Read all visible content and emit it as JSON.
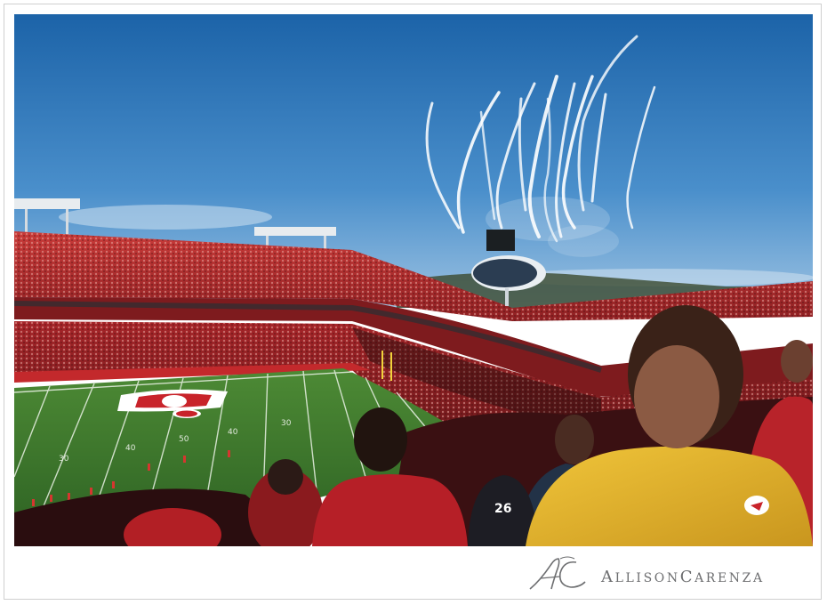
{
  "photo": {
    "subject": "stadium-fireworks",
    "colors": {
      "sky_top": "#1a6ab0",
      "sky_bottom": "#7fb0da",
      "crowd_red": "#b3262b",
      "field_green": "#3f7a2e",
      "shirt_yellow": "#e6b92d"
    }
  },
  "branding": {
    "name": "AllisonCarenza",
    "monogram": "AC",
    "color": "#6d6e70"
  }
}
